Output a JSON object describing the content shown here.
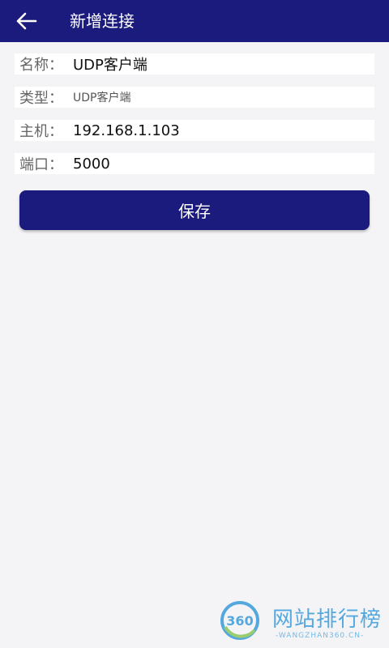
{
  "header": {
    "title": "新增连接",
    "back_icon": "arrow-left-icon"
  },
  "form": {
    "name": {
      "label": "名称：",
      "value": "UDP客户端"
    },
    "type": {
      "label": "类型：",
      "value": "UDP客户端"
    },
    "host": {
      "label": "主机：",
      "value": "192.168.1.103"
    },
    "port": {
      "label": "端口：",
      "value": "5000"
    }
  },
  "actions": {
    "save_label": "保存"
  },
  "watermark": {
    "logo_text": "360",
    "name": "网站排行榜",
    "url": "-WANGZHAN360.CN-"
  },
  "colors": {
    "primary": "#1b1b7e",
    "background": "#f4f4f6",
    "watermark": "#1f8fd6"
  }
}
